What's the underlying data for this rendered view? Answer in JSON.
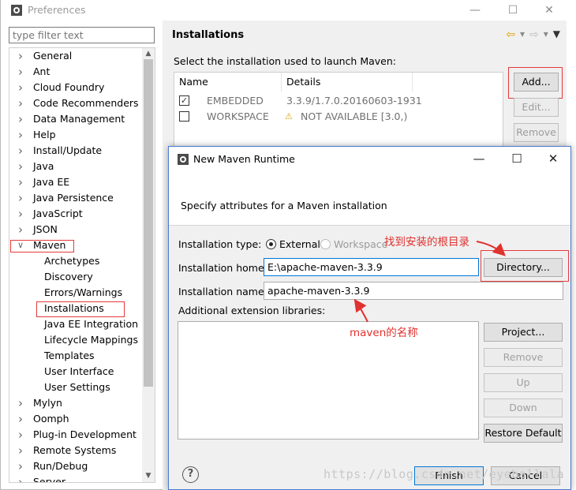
{
  "prefs": {
    "title": "Preferences",
    "filter_placeholder": "type filter text",
    "tree": [
      {
        "label": "General",
        "level": 0
      },
      {
        "label": "Ant",
        "level": 0
      },
      {
        "label": "Cloud Foundry",
        "level": 0
      },
      {
        "label": "Code Recommenders",
        "level": 0
      },
      {
        "label": "Data Management",
        "level": 0
      },
      {
        "label": "Help",
        "level": 0
      },
      {
        "label": "Install/Update",
        "level": 0
      },
      {
        "label": "Java",
        "level": 0
      },
      {
        "label": "Java EE",
        "level": 0
      },
      {
        "label": "Java Persistence",
        "level": 0
      },
      {
        "label": "JavaScript",
        "level": 0
      },
      {
        "label": "JSON",
        "level": 0
      },
      {
        "label": "Maven",
        "level": 0,
        "expanded": true
      },
      {
        "label": "Archetypes",
        "level": 1
      },
      {
        "label": "Discovery",
        "level": 1
      },
      {
        "label": "Errors/Warnings",
        "level": 1
      },
      {
        "label": "Installations",
        "level": 1,
        "selected": true
      },
      {
        "label": "Java EE Integration",
        "level": 1
      },
      {
        "label": "Lifecycle Mappings",
        "level": 1
      },
      {
        "label": "Templates",
        "level": 1
      },
      {
        "label": "User Interface",
        "level": 1
      },
      {
        "label": "User Settings",
        "level": 1
      },
      {
        "label": "Mylyn",
        "level": 0
      },
      {
        "label": "Oomph",
        "level": 0
      },
      {
        "label": "Plug-in Development",
        "level": 0
      },
      {
        "label": "Remote Systems",
        "level": 0
      },
      {
        "label": "Run/Debug",
        "level": 0
      },
      {
        "label": "Server",
        "level": 0
      }
    ]
  },
  "installations": {
    "title": "Installations",
    "prompt": "Select the installation used to launch Maven:",
    "columns": [
      "Name",
      "Details"
    ],
    "rows": [
      {
        "checked": true,
        "name": "EMBEDDED",
        "details": "3.3.9/1.7.0.20160603-1931",
        "warning": false
      },
      {
        "checked": false,
        "name": "WORKSPACE",
        "details": "NOT AVAILABLE [3.0,)",
        "warning": true
      }
    ],
    "buttons": {
      "add": "Add...",
      "edit": "Edit...",
      "remove": "Remove"
    }
  },
  "dialog": {
    "title": "New Maven Runtime",
    "description": "Specify attributes for a Maven installation",
    "type_label": "Installation type:",
    "type_external": "External",
    "type_workspace": "Workspace",
    "home_label": "Installation home:",
    "home_value": "E:\\apache-maven-3.3.9",
    "directory_button": "Directory...",
    "name_label": "Installation name:",
    "name_value": "apache-maven-3.3.9",
    "ext_label": "Additional extension libraries:",
    "buttons": {
      "project": "Project...",
      "remove": "Remove",
      "up": "Up",
      "down": "Down",
      "restore": "Restore Default",
      "finish": "Finish",
      "cancel": "Cancel"
    },
    "help": "?"
  },
  "annotations": {
    "root_dir": "找到安装的根目录",
    "maven_name": "maven的名称"
  },
  "watermark": "https://blog.csdn.net/eyeballala"
}
